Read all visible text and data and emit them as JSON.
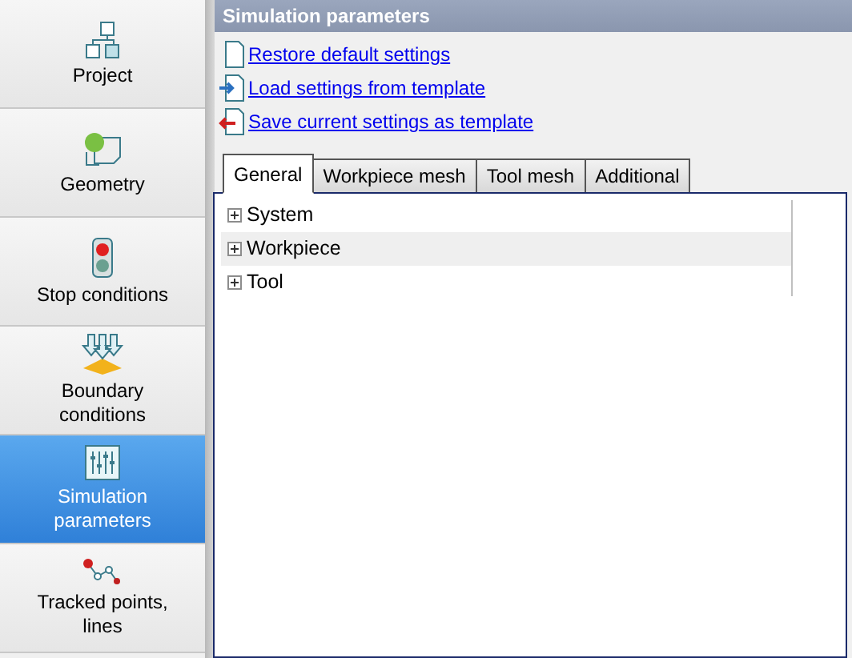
{
  "sidebar": {
    "items": [
      {
        "kind": "project",
        "label": "Project",
        "selected": false
      },
      {
        "kind": "geometry",
        "label": "Geometry",
        "selected": false
      },
      {
        "kind": "stop",
        "label": "Stop conditions",
        "selected": false
      },
      {
        "kind": "boundary",
        "label": "Boundary conditions",
        "selected": false
      },
      {
        "kind": "simulation",
        "label": "Simulation parameters",
        "selected": true
      },
      {
        "kind": "tracked",
        "label": "Tracked points, lines",
        "selected": false
      }
    ]
  },
  "panel": {
    "title": "Simulation parameters",
    "links": [
      {
        "kind": "restore",
        "label": "Restore default settings"
      },
      {
        "kind": "load",
        "label": "Load settings from template"
      },
      {
        "kind": "save",
        "label": "Save current settings as template"
      }
    ],
    "tabs": [
      {
        "label": "General",
        "selected": true
      },
      {
        "label": "Workpiece mesh",
        "selected": false
      },
      {
        "label": "Tool mesh",
        "selected": false
      },
      {
        "label": "Additional",
        "selected": false
      }
    ],
    "tree": [
      {
        "label": "System",
        "expanded": false,
        "selected": false
      },
      {
        "label": "Workpiece",
        "expanded": false,
        "selected": true
      },
      {
        "label": "Tool",
        "expanded": false,
        "selected": false
      }
    ]
  }
}
